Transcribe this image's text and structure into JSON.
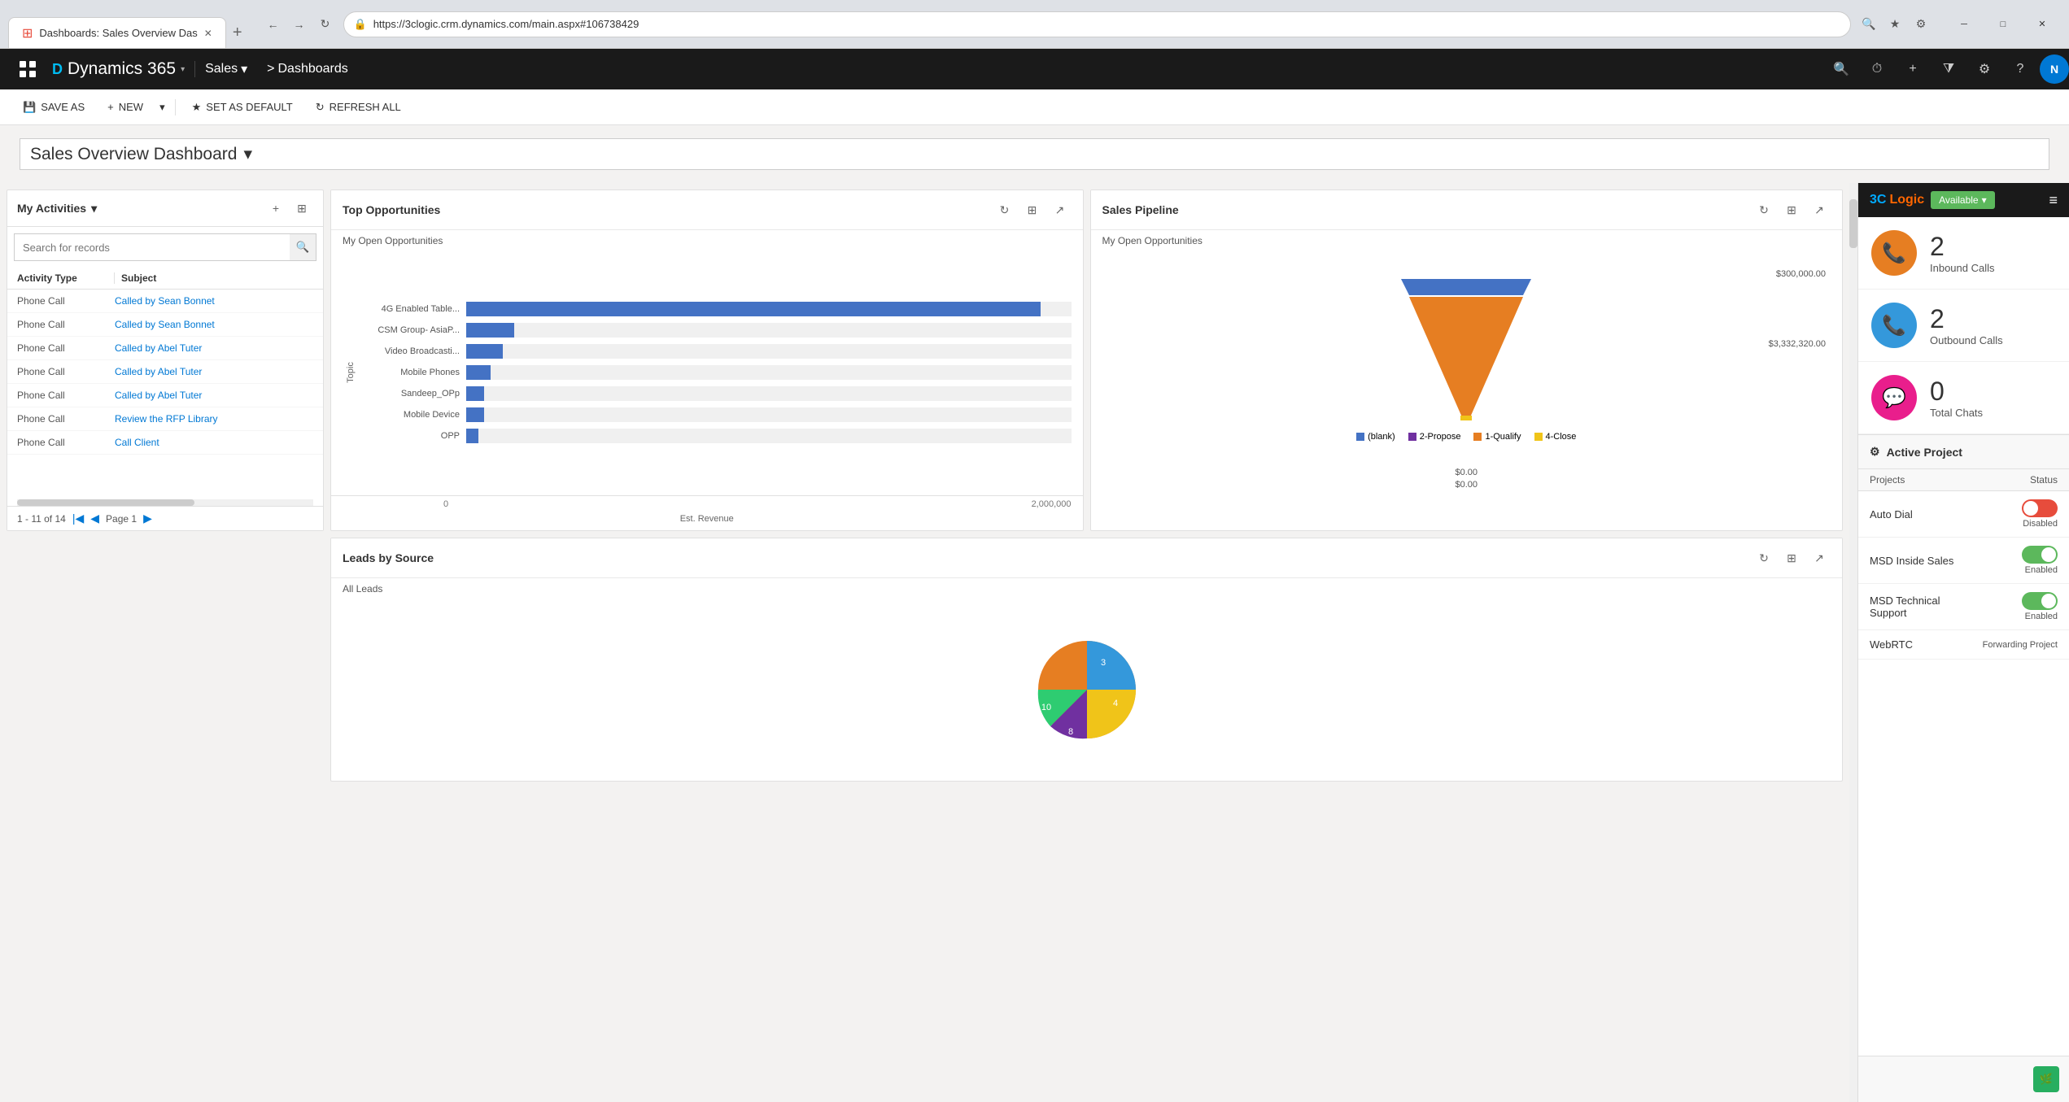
{
  "browser": {
    "tab_title": "Dashboards: Sales Overview Das",
    "url": "https://3clogic.crm.dynamics.com/main.aspx#106738429",
    "new_tab_label": "+",
    "window_controls": {
      "minimize": "─",
      "maximize": "□",
      "close": "✕"
    }
  },
  "appbar": {
    "grid_icon": "⊞",
    "app_name": "Dynamics 365",
    "app_chevron": "▾",
    "module": "Sales",
    "module_chevron": "▾",
    "breadcrumb": "Dashboards",
    "breadcrumb_sep": ">",
    "search_icon": "🔍",
    "history_icon": "⏱",
    "add_icon": "+",
    "filter_icon": "⧩",
    "settings_icon": "⚙",
    "help_icon": "?",
    "avatar_initials": "N"
  },
  "toolbar": {
    "save_as": "SAVE AS",
    "new": "NEW",
    "dropdown": "▾",
    "set_default": "SET AS DEFAULT",
    "refresh_all": "REFRESH ALL"
  },
  "dashboard": {
    "title": "Sales Overview Dashboard",
    "title_dropdown": "▾"
  },
  "my_activities": {
    "title": "My Activities",
    "title_chevron": "▾",
    "search_placeholder": "Search for records",
    "col_activity_type": "Activity Type",
    "col_subject": "Subject",
    "rows": [
      {
        "type": "Phone Call",
        "subject": "Called by Sean Bonnet"
      },
      {
        "type": "Phone Call",
        "subject": "Called by Sean Bonnet"
      },
      {
        "type": "Phone Call",
        "subject": "Called by Abel Tuter"
      },
      {
        "type": "Phone Call",
        "subject": "Called by Abel Tuter"
      },
      {
        "type": "Phone Call",
        "subject": "Called by Abel Tuter"
      },
      {
        "type": "Phone Call",
        "subject": "Review the RFP Library"
      },
      {
        "type": "Phone Call",
        "subject": "Call Client"
      }
    ],
    "pager_info": "1 - 11 of 14",
    "page_label": "Page 1"
  },
  "top_opportunities": {
    "title": "Top Opportunities",
    "subtitle": "My Open Opportunities",
    "y_axis_label": "Topic",
    "x_axis_label": "Est. Revenue",
    "bars": [
      {
        "label": "4G Enabled Table...",
        "value": 95,
        "display": ""
      },
      {
        "label": "CSM Group- AsiaP...",
        "value": 8,
        "display": ""
      },
      {
        "label": "Video Broadcasti...",
        "value": 6,
        "display": ""
      },
      {
        "label": "Mobile Phones",
        "value": 4,
        "display": ""
      },
      {
        "label": "Sandeep_OPp",
        "value": 3,
        "display": ""
      },
      {
        "label": "Mobile Device",
        "value": 3,
        "display": ""
      },
      {
        "label": "OPP",
        "value": 2,
        "display": ""
      }
    ],
    "axis_ticks": [
      "0",
      "2,000,000"
    ]
  },
  "sales_pipeline": {
    "title": "Sales Pipeline",
    "subtitle": "My Open Opportunities",
    "funnel_top_value": "$300,000.00",
    "funnel_mid_value": "$3,332,320.00",
    "funnel_bot_value": "$0.00",
    "funnel_bot2_value": "$0.00",
    "legend": [
      {
        "label": "(blank)",
        "color": "#4472c4"
      },
      {
        "label": "2-Propose",
        "color": "#7030a0"
      },
      {
        "label": "1-Qualify",
        "color": "#e67e22"
      },
      {
        "label": "4-Close",
        "color": "#f0c419"
      }
    ]
  },
  "leads_by_source": {
    "title": "Leads by Source",
    "subtitle": "All Leads"
  },
  "sidebar": {
    "logo": "3CLogic",
    "available_label": "Available",
    "available_chevron": "▾",
    "menu_icon": "≡",
    "inbound_calls": {
      "label": "Inbound Calls",
      "count": "2",
      "color": "#e67e22"
    },
    "outbound_calls": {
      "label": "Outbound Calls",
      "count": "2",
      "color": "#3498db"
    },
    "total_chats": {
      "label": "Total Chats",
      "count": "0",
      "color": "#e91e8c"
    },
    "active_project": {
      "header": "Active Project",
      "col_projects": "Projects",
      "col_status": "Status",
      "rows": [
        {
          "name": "Auto Dial",
          "status_label": "Disabled",
          "toggle_state": "on",
          "toggle_color": "red"
        },
        {
          "name": "MSD Inside Sales",
          "status_label": "Enabled",
          "toggle_state": "off",
          "toggle_color": "green"
        },
        {
          "name": "MSD Technical Support",
          "status_label": "Enabled",
          "toggle_state": "off",
          "toggle_color": "green"
        },
        {
          "name": "WebRTC",
          "status_label": "Forwarding Project",
          "toggle_state": "none",
          "toggle_color": "none"
        }
      ]
    }
  }
}
